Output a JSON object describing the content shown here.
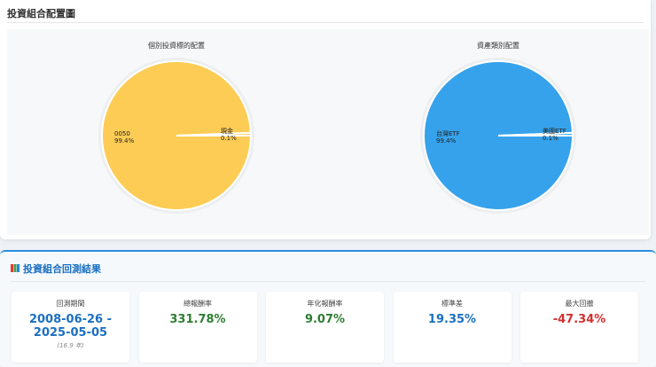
{
  "allocation": {
    "title": "投資組合配置圖",
    "charts": [
      {
        "title": "個別投資標的配置",
        "slices": [
          {
            "label": "0050",
            "value": 99.4,
            "pct": "99.4%",
            "color": "#fdcc55"
          },
          {
            "label": "現金",
            "value": 0.6,
            "pct": "0.1%",
            "color": "#fdcc55"
          }
        ]
      },
      {
        "title": "資產類別配置",
        "slices": [
          {
            "label": "台灣ETF",
            "value": 99.4,
            "pct": "99.4%",
            "color": "#36a2eb"
          },
          {
            "label": "美國ETF",
            "value": 0.6,
            "pct": "0.1%",
            "color": "#36a2eb"
          }
        ]
      }
    ]
  },
  "results": {
    "icon": "bar-chart-icon",
    "title": "投資組合回測結果",
    "metrics": [
      {
        "label": "回測期間",
        "value": "2008-06-26 - 2025-05-05",
        "sub": "(16.9 年)",
        "color": "#1a6fc2"
      },
      {
        "label": "總報酬率",
        "value": "331.78%",
        "color": "#2e7d32"
      },
      {
        "label": "年化報酬率",
        "value": "9.07%",
        "color": "#2e7d32"
      },
      {
        "label": "標準差",
        "value": "19.35%",
        "color": "#1a6fc2"
      },
      {
        "label": "最大回撤",
        "value": "-47.34%",
        "color": "#d32f2f"
      }
    ]
  }
}
